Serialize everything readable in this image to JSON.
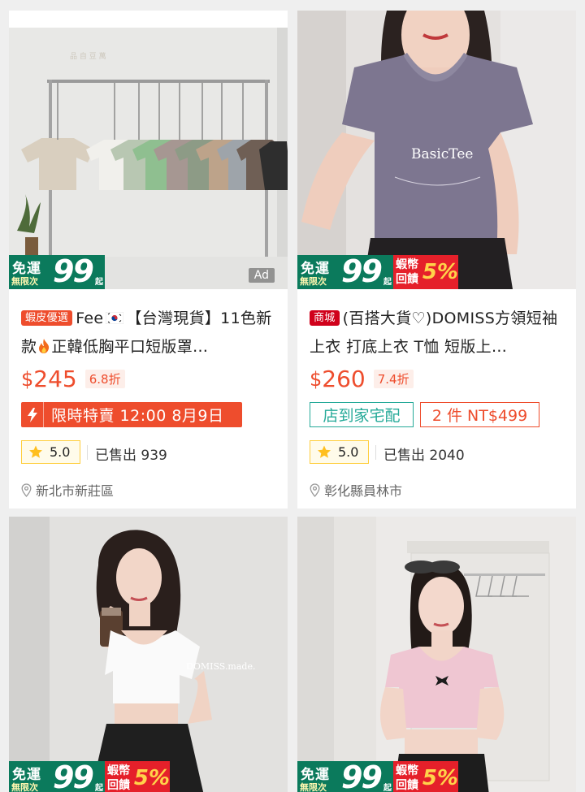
{
  "colors": {
    "accent": "#ee4d2d",
    "ship_green": "#0b7a5c",
    "home_delivery": "#26aa99"
  },
  "products": [
    {
      "tag": "蝦皮優選",
      "title_pre": "Fee",
      "title_post": "【台灣現貨】11色新款",
      "title_tail": "正韓低胸平口短版罩…",
      "price_currency": "$",
      "price_value": "245",
      "discount": "6.8折",
      "flash_sale": "限時特賣 12:00 8月9日",
      "rating": "5.0",
      "sold": "已售出 939",
      "location": "新北市新莊區",
      "ship_top": "免運",
      "ship_bottom": "無限次",
      "ship_amount": "99",
      "ship_unit": "起",
      "ad": "Ad",
      "icon": "flame-icon"
    },
    {
      "tag": "商城",
      "title": "(百搭大貨♡)DOMISS方領短袖上衣 打底上衣 T恤 短版上…",
      "price_currency": "$",
      "price_value": "260",
      "discount": "7.4折",
      "chip_home": "店到家宅配",
      "chip_bundle": "2 件 NT$499",
      "rating": "5.0",
      "sold": "已售出 2040",
      "location": "彰化縣員林市",
      "ship_top": "免運",
      "ship_bottom": "無限次",
      "ship_amount": "99",
      "ship_unit": "起",
      "coin_text": "蝦幣回饋",
      "coin_percent": "5%",
      "image_text": "BasicTee"
    },
    {
      "ship_top": "免運",
      "ship_bottom": "無限次",
      "ship_amount": "99",
      "ship_unit": "起",
      "coin_text": "蝦幣回饋",
      "coin_percent": "5%",
      "image_text": "DOMISS.made."
    },
    {
      "ship_top": "免運",
      "ship_bottom": "無限次",
      "ship_amount": "99",
      "ship_unit": "起",
      "coin_text": "蝦幣回饋",
      "coin_percent": "5%"
    }
  ]
}
